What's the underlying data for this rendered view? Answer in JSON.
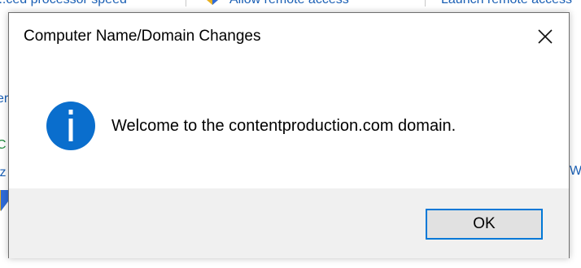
{
  "background": {
    "top_links": [
      "...ced processor speed",
      "Allow remote access",
      "Launch remote access"
    ],
    "left_edge_text": [
      "er",
      "C",
      "iz"
    ],
    "right_edge_text": "W"
  },
  "dialog": {
    "title": "Computer Name/Domain Changes",
    "message": "Welcome to the contentproduction.com domain.",
    "icon": "info-icon",
    "buttons": {
      "ok_label": "OK",
      "close_icon": "close-icon"
    }
  },
  "colors": {
    "info_icon_blue": "#0a6ecd",
    "button_focus_border": "#0078d7",
    "button_face": "#e1e1e1",
    "button_area": "#f0f0f0",
    "link_blue": "#1a5fb4"
  }
}
